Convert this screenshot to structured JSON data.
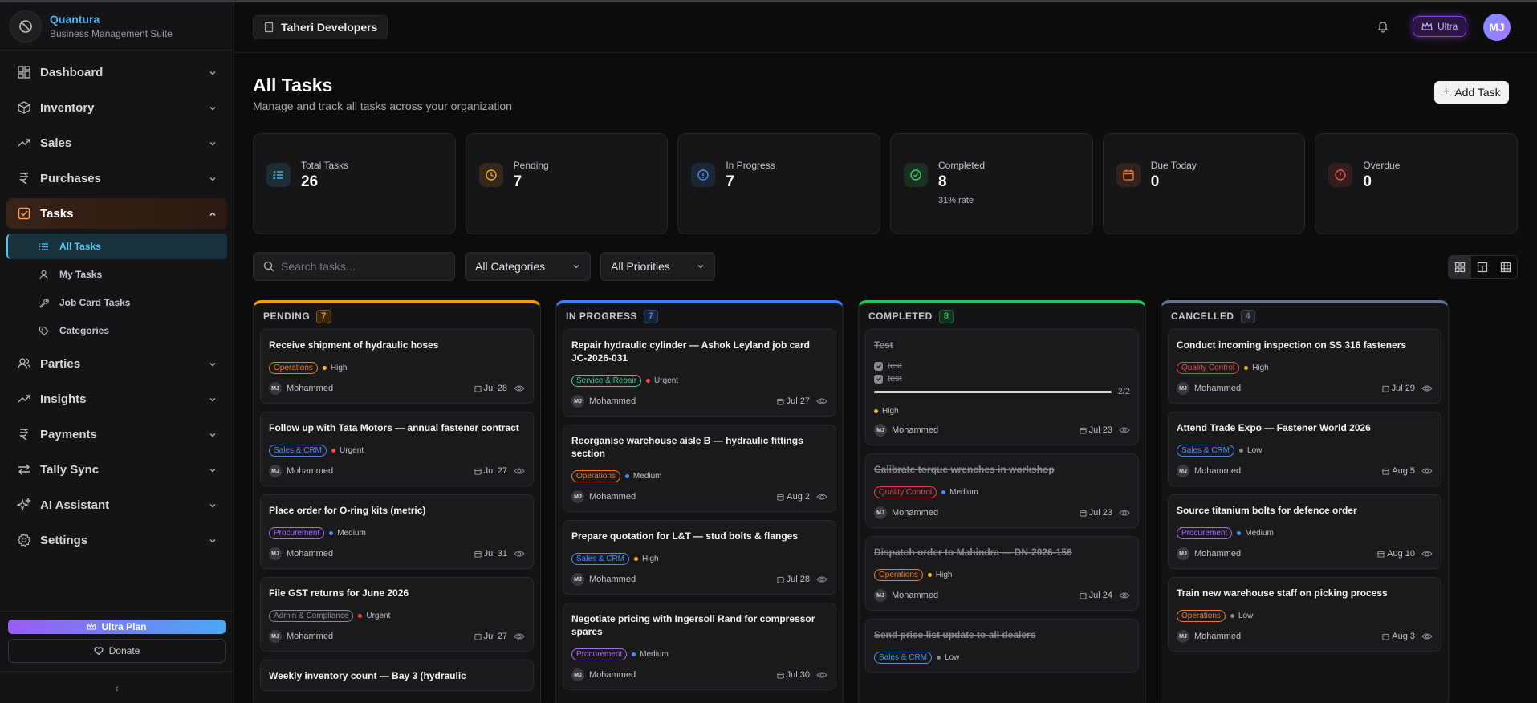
{
  "brand": {
    "name": "Quantura",
    "subtitle": "Business Management Suite"
  },
  "sidebar": {
    "items": [
      {
        "label": "Dashboard",
        "icon": "dashboard-icon"
      },
      {
        "label": "Inventory",
        "icon": "box-icon"
      },
      {
        "label": "Sales",
        "icon": "trend-icon"
      },
      {
        "label": "Purchases",
        "icon": "rupee-icon"
      },
      {
        "label": "Tasks",
        "icon": "checkbox-icon"
      },
      {
        "label": "Parties",
        "icon": "users-icon"
      },
      {
        "label": "Insights",
        "icon": "trend-icon"
      },
      {
        "label": "Payments",
        "icon": "rupee-icon"
      },
      {
        "label": "Tally Sync",
        "icon": "sync-icon"
      },
      {
        "label": "AI Assistant",
        "icon": "sparkle-icon"
      },
      {
        "label": "Settings",
        "icon": "gear-icon"
      }
    ],
    "tasks_sub": [
      {
        "label": "All Tasks",
        "icon": "list-icon"
      },
      {
        "label": "My Tasks",
        "icon": "user-icon"
      },
      {
        "label": "Job Card Tasks",
        "icon": "wrench-icon"
      },
      {
        "label": "Categories",
        "icon": "tag-icon"
      }
    ],
    "ultra_plan": "Ultra Plan",
    "donate": "Donate",
    "collapse": "‹"
  },
  "header": {
    "org": "Taheri Developers",
    "badge": "Ultra",
    "avatar": "MJ"
  },
  "page": {
    "title": "All Tasks",
    "subtitle": "Manage and track all tasks across your organization",
    "add_task": "Add Task"
  },
  "stats": [
    {
      "label": "Total Tasks",
      "value": "26",
      "note": "",
      "color": "#4fc6f5"
    },
    {
      "label": "Pending",
      "value": "7",
      "note": "",
      "color": "#f5a623"
    },
    {
      "label": "In Progress",
      "value": "7",
      "note": "",
      "color": "#4a8cf5"
    },
    {
      "label": "Completed",
      "value": "8",
      "note": "31% rate",
      "color": "#3ecf6a"
    },
    {
      "label": "Due Today",
      "value": "0",
      "note": "",
      "color": "#f57a3a"
    },
    {
      "label": "Overdue",
      "value": "0",
      "note": "",
      "color": "#f54a4a"
    }
  ],
  "filters": {
    "search_placeholder": "Search tasks...",
    "category": "All Categories",
    "priority": "All Priorities"
  },
  "columns": [
    {
      "title": "PENDING",
      "count": "7",
      "color": "#f59e0b",
      "cards": [
        {
          "title": "Receive shipment of hydraulic hoses",
          "tag": "Operations",
          "tag_color": "#f07a2a",
          "priority": "High",
          "prio_color": "#f5b92a",
          "assignee": "Mohammed",
          "date": "Jul 28"
        },
        {
          "title": "Follow up with Tata Motors — annual fastener contract",
          "tag": "Sales & CRM",
          "tag_color": "#4a8cf5",
          "priority": "Urgent",
          "prio_color": "#f54a4a",
          "assignee": "Mohammed",
          "date": "Jul 27"
        },
        {
          "title": "Place order for O-ring kits (metric)",
          "tag": "Procurement",
          "tag_color": "#a86af5",
          "priority": "Medium",
          "prio_color": "#4a8cf5",
          "assignee": "Mohammed",
          "date": "Jul 31"
        },
        {
          "title": "File GST returns for June 2026",
          "tag": "Admin & Compliance",
          "tag_color": "#8a8a90",
          "priority": "Urgent",
          "prio_color": "#f54a4a",
          "assignee": "Mohammed",
          "date": "Jul 27"
        },
        {
          "title": "Weekly inventory count — Bay 3 (hydraulic",
          "tag": "",
          "tag_color": "#8a8a90",
          "priority": "",
          "prio_color": "#8a8a90",
          "assignee": "",
          "date": ""
        }
      ]
    },
    {
      "title": "IN PROGRESS",
      "count": "7",
      "color": "#3b82f6",
      "cards": [
        {
          "title": "Repair hydraulic cylinder — Ashok Leyland job card JC-2026-031",
          "tag": "Service & Repair",
          "tag_color": "#3ecf8e",
          "priority": "Urgent",
          "prio_color": "#f54a4a",
          "assignee": "Mohammed",
          "date": "Jul 27"
        },
        {
          "title": "Reorganise warehouse aisle B — hydraulic fittings section",
          "tag": "Operations",
          "tag_color": "#f07a2a",
          "priority": "Medium",
          "prio_color": "#4a8cf5",
          "assignee": "Mohammed",
          "date": "Aug 2"
        },
        {
          "title": "Prepare quotation for L&T — stud bolts & flanges",
          "tag": "Sales & CRM",
          "tag_color": "#4a8cf5",
          "priority": "High",
          "prio_color": "#f5b92a",
          "assignee": "Mohammed",
          "date": "Jul 28"
        },
        {
          "title": "Negotiate pricing with Ingersoll Rand for compressor spares",
          "tag": "Procurement",
          "tag_color": "#a86af5",
          "priority": "Medium",
          "prio_color": "#4a8cf5",
          "assignee": "Mohammed",
          "date": "Jul 30"
        }
      ]
    },
    {
      "title": "COMPLETED",
      "count": "8",
      "color": "#22c55e",
      "cards": [
        {
          "title": "Test",
          "checks": [
            "test",
            "test"
          ],
          "progress": 1.0,
          "progress_label": "2/2",
          "tag": "",
          "tag_color": "#8a8a90",
          "priority": "High",
          "prio_color": "#f5b92a",
          "assignee": "Mohammed",
          "date": "Jul 23"
        },
        {
          "title": "Calibrate torque wrenches in workshop",
          "tag": "Quality Control",
          "tag_color": "#e54a4a",
          "priority": "Medium",
          "prio_color": "#4a8cf5",
          "assignee": "Mohammed",
          "date": "Jul 23"
        },
        {
          "title": "Dispatch order to Mahindra — DN-2026-156",
          "tag": "Operations",
          "tag_color": "#f07a2a",
          "priority": "High",
          "prio_color": "#f5b92a",
          "assignee": "Mohammed",
          "date": "Jul 24"
        },
        {
          "title": "Send price list update to all dealers",
          "tag": "Sales & CRM",
          "tag_color": "#4a8cf5",
          "priority": "Low",
          "prio_color": "#8a8a90",
          "assignee": "",
          "date": ""
        }
      ]
    },
    {
      "title": "CANCELLED",
      "count": "4",
      "color": "#64748b",
      "cards": [
        {
          "title": "Conduct incoming inspection on SS 316 fasteners",
          "tag": "Quality Control",
          "tag_color": "#e54a4a",
          "priority": "High",
          "prio_color": "#f5b92a",
          "assignee": "Mohammed",
          "date": "Jul 29"
        },
        {
          "title": "Attend Trade Expo — Fastener World 2026",
          "tag": "Sales & CRM",
          "tag_color": "#4a8cf5",
          "priority": "Low",
          "prio_color": "#8a8a90",
          "assignee": "Mohammed",
          "date": "Aug 5"
        },
        {
          "title": "Source titanium bolts for defence order",
          "tag": "Procurement",
          "tag_color": "#a86af5",
          "priority": "Medium",
          "prio_color": "#4a8cf5",
          "assignee": "Mohammed",
          "date": "Aug 10"
        },
        {
          "title": "Train new warehouse staff on picking process",
          "tag": "Operations",
          "tag_color": "#f07a2a",
          "priority": "Low",
          "prio_color": "#8a8a90",
          "assignee": "Mohammed",
          "date": "Aug 3"
        }
      ]
    }
  ],
  "card_avatar": "MJ"
}
